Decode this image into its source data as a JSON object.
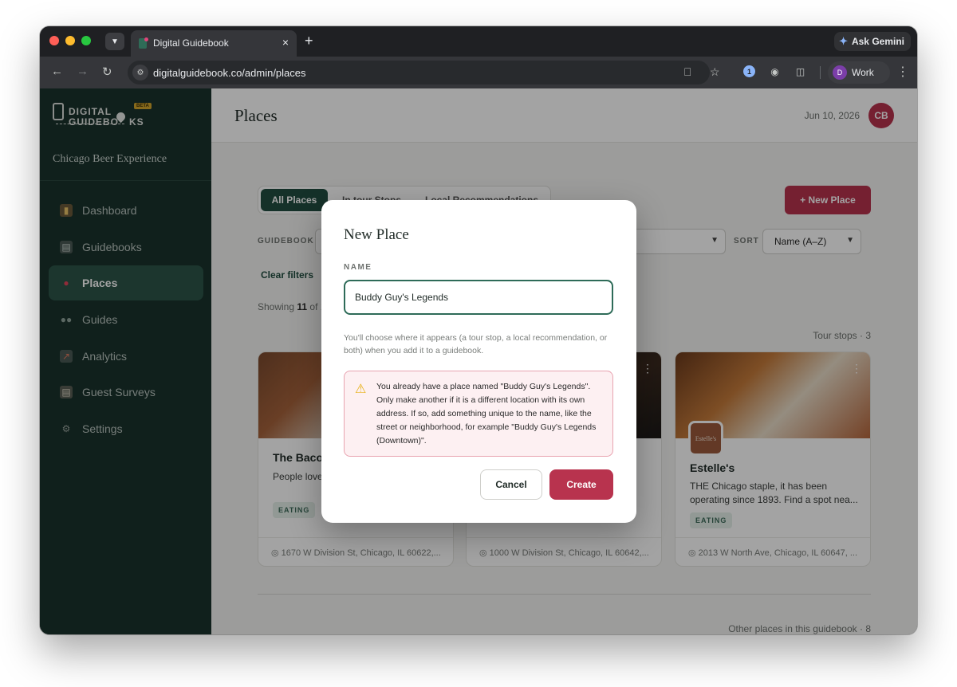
{
  "browser": {
    "tab_title": "Digital Guidebook",
    "tab_close": "×",
    "new_tab": "+",
    "ask_gemini": "Ask Gemini",
    "url": "digitalguidebook.co/admin/places",
    "profile_initial": "D",
    "profile_name": "Work"
  },
  "sidebar": {
    "logo_line1": "DIGITAL",
    "logo_line2": "GUIDEBO",
    "logo_line2_end": "KS",
    "beta": "BETA",
    "org_name": "Chicago Beer Experience",
    "items": [
      {
        "label": "Dashboard",
        "icon": "bar-chart-icon",
        "active": false
      },
      {
        "label": "Guidebooks",
        "icon": "book-icon",
        "active": false
      },
      {
        "label": "Places",
        "icon": "pin-icon",
        "active": true
      },
      {
        "label": "Guides",
        "icon": "people-icon",
        "active": false
      },
      {
        "label": "Analytics",
        "icon": "chart-up-icon",
        "active": false
      },
      {
        "label": "Guest Surveys",
        "icon": "clipboard-icon",
        "active": false
      },
      {
        "label": "Settings",
        "icon": "gear-icon",
        "active": false
      }
    ]
  },
  "header": {
    "title": "Places",
    "date": "Jun 10, 2026",
    "user_initials": "CB"
  },
  "filters": {
    "tabs": [
      "All Places",
      "In tour Stops",
      "Local Recommendations"
    ],
    "new_place": "+ New Place",
    "guidebook_label": "GUIDEBOOK",
    "tags_value": "tags",
    "sort_label": "SORT",
    "sort_value": "Name (A–Z)",
    "clear_filters": "Clear filters",
    "showing_prefix": "Showing ",
    "showing_count": "11",
    "showing_suffix": " of 1",
    "tour_stops": "Tour stops · 3",
    "other_places": "Other places in this guidebook · 8"
  },
  "cards": [
    {
      "name": "The Baco",
      "description": "People love obvious rea",
      "tag": "EATING",
      "address": "1670 W Division St, Chicago, IL 60622,..."
    },
    {
      "name": "",
      "description": "",
      "tag": "",
      "address": "1000 W Division St, Chicago, IL 60642,..."
    },
    {
      "name": "Estelle's",
      "logo_text": "Estelle's",
      "description": "THE Chicago staple, it has been operating since 1893. Find a spot nea...",
      "tag": "EATING",
      "address": "2013 W North Ave, Chicago, IL 60647, ..."
    }
  ],
  "modal": {
    "title": "New Place",
    "name_label": "NAME",
    "name_value": "Buddy Guy's Legends",
    "help_text": "You'll choose where it appears (a tour stop, a local recommendation, or both) when you add it to a guidebook.",
    "warning_text": "You already have a place named \"Buddy Guy's Legends\". Only make another if it is a different location with its own address. If so, add something unique to the name, like the street or neighborhood, for example \"Buddy Guy's Legends (Downtown)\".",
    "cancel": "Cancel",
    "create": "Create"
  },
  "colors": {
    "sidebar_bg": "#1a332c",
    "accent_green": "#214e40",
    "accent_red": "#b8334e",
    "warning_bg": "#fdf0f2"
  }
}
